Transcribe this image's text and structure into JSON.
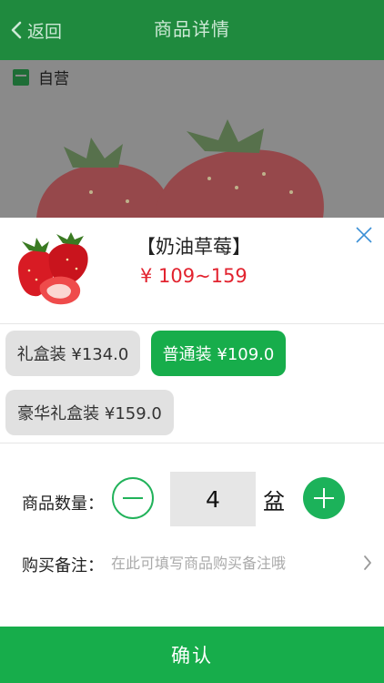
{
  "header": {
    "back_label": "返回",
    "title": "商品详情"
  },
  "background": {
    "store_label": "自营"
  },
  "product": {
    "name": "【奶油草莓】",
    "price": "¥ 109~159"
  },
  "options": [
    {
      "label": "礼盒装 ¥134.0",
      "selected": false
    },
    {
      "label": "普通装 ¥109.0",
      "selected": true
    },
    {
      "label": "豪华礼盒装 ¥159.0",
      "selected": false
    }
  ],
  "quantity": {
    "label": "商品数量：",
    "value": "4",
    "unit": "盆"
  },
  "note": {
    "label": "购买备注：",
    "placeholder": "在此可填写商品购买备注哦"
  },
  "confirm_label": "确认",
  "colors": {
    "accent": "#17ad4b",
    "header": "#1f8a3e",
    "price": "#e2232f"
  }
}
